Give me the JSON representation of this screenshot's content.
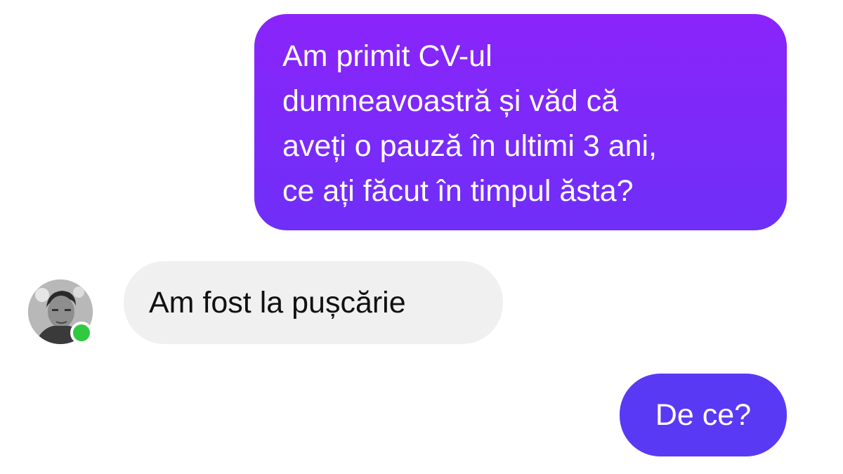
{
  "messages": {
    "outgoing_1": {
      "lines": [
        "Am primit CV-ul",
        "dumneavoastră și văd că",
        "aveți o pauză în ultimi 3 ani,",
        "ce ați făcut în timpul ăsta?"
      ]
    },
    "incoming_1": {
      "text": "Am fost la pușcărie"
    },
    "outgoing_2": {
      "text": "De ce?"
    }
  },
  "contact": {
    "avatar_icon": "person-avatar",
    "status": "online",
    "status_color": "#31c93f"
  },
  "colors": {
    "outgoing_bubble_top": "#8a24fb",
    "outgoing_bubble_bottom": "#6f2ff8",
    "outgoing_bubble_short": "#5a39f4",
    "incoming_bubble": "#f0f0f0",
    "background": "#ffffff"
  }
}
